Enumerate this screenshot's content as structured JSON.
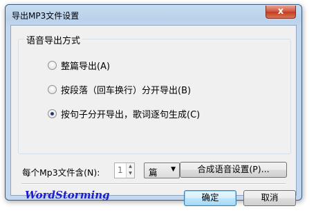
{
  "window": {
    "title": "导出MP3文件设置",
    "close_glyph": "x"
  },
  "group": {
    "legend": "语音导出方式",
    "options": [
      {
        "label": "整篇导出(A)",
        "checked": false
      },
      {
        "label": "按段落（回车换行）分开导出(B)",
        "checked": false
      },
      {
        "label": "按句子分开导出，歌词逐句生成(C)",
        "checked": true
      }
    ]
  },
  "count": {
    "label": "每个Mp3文件含(N):",
    "value": "1",
    "unit": "篇"
  },
  "buttons": {
    "synth_settings": "合成语音设置(P)...",
    "ok": "确定",
    "cancel": "取消"
  },
  "brand": "WordStorming",
  "colors": {
    "brand_text": "#1c1ccd",
    "close_button": "#c13b22",
    "window_frame": "#c3d8ee",
    "dialog_bg": "#f0f0f0"
  }
}
